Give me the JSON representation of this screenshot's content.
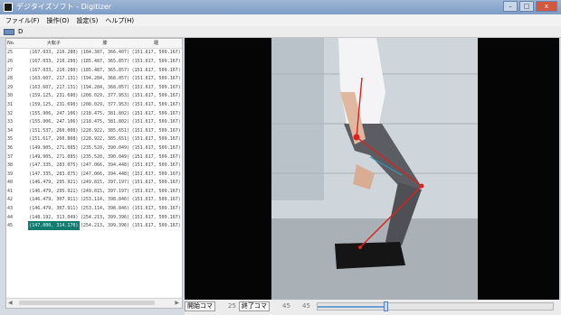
{
  "window": {
    "title": "デジタイズソフト - Digitizer",
    "buttons": [
      "–",
      "□",
      "x"
    ]
  },
  "menu": {
    "items": [
      "ファイル(F)",
      "操作(O)",
      "設定(S)",
      "ヘルプ(H)"
    ]
  },
  "toolbar": {
    "label": "D"
  },
  "table": {
    "headers": [
      "No.",
      "大転子",
      "膝",
      "踵"
    ],
    "rows": [
      [
        "25",
        "(167.033, 210.280)",
        "(184.387, 366.407)",
        "(151.617, 509.167)"
      ],
      [
        "26",
        "(167.033, 210.280)",
        "(185.487, 365.857)",
        "(151.617, 509.167)"
      ],
      [
        "27",
        "(167.033, 210.280)",
        "(185.487, 365.857)",
        "(151.617, 509.167)"
      ],
      [
        "28",
        "(163.607, 217.131)",
        "(194.284, 368.057)",
        "(151.617, 509.167)"
      ],
      [
        "29",
        "(163.607, 217.131)",
        "(194.284, 368.057)",
        "(151.617, 509.167)"
      ],
      [
        "30",
        "(159.125, 231.690)",
        "(208.029, 377.953)",
        "(151.617, 509.167)"
      ],
      [
        "31",
        "(159.125, 231.690)",
        "(208.029, 377.953)",
        "(151.617, 509.167)"
      ],
      [
        "32",
        "(155.906, 247.106)",
        "(218.475, 381.802)",
        "(151.617, 509.167)"
      ],
      [
        "33",
        "(155.906, 247.106)",
        "(218.475, 381.802)",
        "(151.617, 509.167)"
      ],
      [
        "34",
        "(151.537, 260.000)",
        "(228.922, 385.651)",
        "(151.617, 509.167)"
      ],
      [
        "35",
        "(151.617, 260.808)",
        "(228.922, 385.651)",
        "(151.617, 509.167)"
      ],
      [
        "36",
        "(149.905, 271.085)",
        "(235.520, 390.049)",
        "(151.617, 509.167)"
      ],
      [
        "37",
        "(149.905, 271.085)",
        "(235.520, 390.049)",
        "(151.617, 509.167)"
      ],
      [
        "38",
        "(147.335, 283.075)",
        "(247.066, 394.448)",
        "(151.617, 509.167)"
      ],
      [
        "39",
        "(147.335, 283.075)",
        "(247.066, 394.448)",
        "(151.617, 509.167)"
      ],
      [
        "40",
        "(146.479, 295.921)",
        "(249.815, 397.197)",
        "(151.617, 509.167)"
      ],
      [
        "41",
        "(146.479, 295.921)",
        "(249.815, 397.197)",
        "(151.617, 509.167)"
      ],
      [
        "42",
        "(146.479, 307.911)",
        "(253.114, 398.846)",
        "(151.617, 509.167)"
      ],
      [
        "43",
        "(146.479, 307.911)",
        "(253.114, 398.846)",
        "(151.617, 509.167)"
      ],
      [
        "44",
        "(148.192, 313.049)",
        "(254.213, 399.396)",
        "(151.617, 509.167)"
      ],
      [
        "45",
        "(147.000, 314.170)",
        "(254.213, 399.396)",
        "(151.617, 509.167)"
      ]
    ],
    "selected_index": 20
  },
  "controls": {
    "start_label": "開始コマ",
    "start_value": "25",
    "end_label": "終了コマ",
    "end_value": "45",
    "frame_value": "45",
    "slider_fraction": 0.29
  },
  "colors": {
    "accent": "#137a70",
    "marker": "#e0201c",
    "guide": "#2aa6c8"
  },
  "icons": {
    "app": "app-icon",
    "toolbar": "digitize-icon",
    "scroll_left": "chevron-left-icon",
    "scroll_right": "chevron-right-icon"
  }
}
